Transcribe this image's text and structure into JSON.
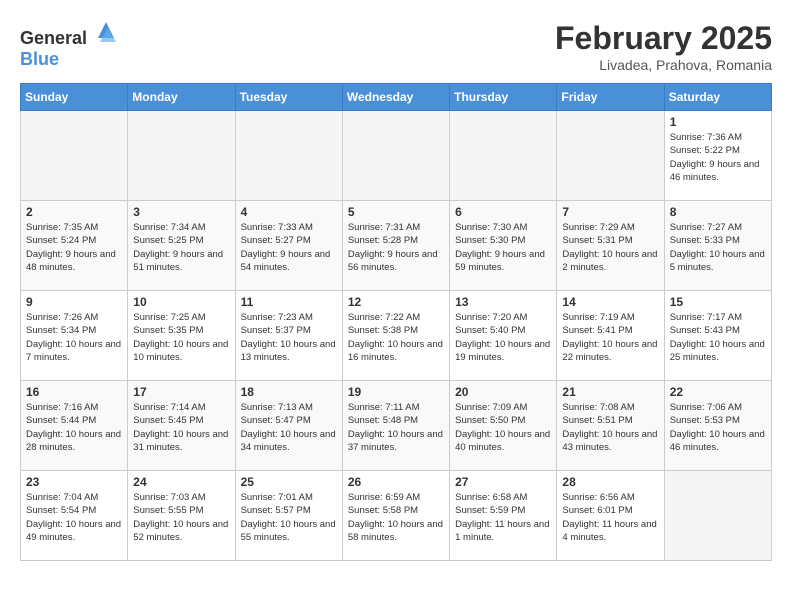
{
  "header": {
    "logo_general": "General",
    "logo_blue": "Blue",
    "title": "February 2025",
    "subtitle": "Livadea, Prahova, Romania"
  },
  "weekdays": [
    "Sunday",
    "Monday",
    "Tuesday",
    "Wednesday",
    "Thursday",
    "Friday",
    "Saturday"
  ],
  "weeks": [
    [
      {
        "day": "",
        "info": ""
      },
      {
        "day": "",
        "info": ""
      },
      {
        "day": "",
        "info": ""
      },
      {
        "day": "",
        "info": ""
      },
      {
        "day": "",
        "info": ""
      },
      {
        "day": "",
        "info": ""
      },
      {
        "day": "1",
        "info": "Sunrise: 7:36 AM\nSunset: 5:22 PM\nDaylight: 9 hours and 46 minutes."
      }
    ],
    [
      {
        "day": "2",
        "info": "Sunrise: 7:35 AM\nSunset: 5:24 PM\nDaylight: 9 hours and 48 minutes."
      },
      {
        "day": "3",
        "info": "Sunrise: 7:34 AM\nSunset: 5:25 PM\nDaylight: 9 hours and 51 minutes."
      },
      {
        "day": "4",
        "info": "Sunrise: 7:33 AM\nSunset: 5:27 PM\nDaylight: 9 hours and 54 minutes."
      },
      {
        "day": "5",
        "info": "Sunrise: 7:31 AM\nSunset: 5:28 PM\nDaylight: 9 hours and 56 minutes."
      },
      {
        "day": "6",
        "info": "Sunrise: 7:30 AM\nSunset: 5:30 PM\nDaylight: 9 hours and 59 minutes."
      },
      {
        "day": "7",
        "info": "Sunrise: 7:29 AM\nSunset: 5:31 PM\nDaylight: 10 hours and 2 minutes."
      },
      {
        "day": "8",
        "info": "Sunrise: 7:27 AM\nSunset: 5:33 PM\nDaylight: 10 hours and 5 minutes."
      }
    ],
    [
      {
        "day": "9",
        "info": "Sunrise: 7:26 AM\nSunset: 5:34 PM\nDaylight: 10 hours and 7 minutes."
      },
      {
        "day": "10",
        "info": "Sunrise: 7:25 AM\nSunset: 5:35 PM\nDaylight: 10 hours and 10 minutes."
      },
      {
        "day": "11",
        "info": "Sunrise: 7:23 AM\nSunset: 5:37 PM\nDaylight: 10 hours and 13 minutes."
      },
      {
        "day": "12",
        "info": "Sunrise: 7:22 AM\nSunset: 5:38 PM\nDaylight: 10 hours and 16 minutes."
      },
      {
        "day": "13",
        "info": "Sunrise: 7:20 AM\nSunset: 5:40 PM\nDaylight: 10 hours and 19 minutes."
      },
      {
        "day": "14",
        "info": "Sunrise: 7:19 AM\nSunset: 5:41 PM\nDaylight: 10 hours and 22 minutes."
      },
      {
        "day": "15",
        "info": "Sunrise: 7:17 AM\nSunset: 5:43 PM\nDaylight: 10 hours and 25 minutes."
      }
    ],
    [
      {
        "day": "16",
        "info": "Sunrise: 7:16 AM\nSunset: 5:44 PM\nDaylight: 10 hours and 28 minutes."
      },
      {
        "day": "17",
        "info": "Sunrise: 7:14 AM\nSunset: 5:45 PM\nDaylight: 10 hours and 31 minutes."
      },
      {
        "day": "18",
        "info": "Sunrise: 7:13 AM\nSunset: 5:47 PM\nDaylight: 10 hours and 34 minutes."
      },
      {
        "day": "19",
        "info": "Sunrise: 7:11 AM\nSunset: 5:48 PM\nDaylight: 10 hours and 37 minutes."
      },
      {
        "day": "20",
        "info": "Sunrise: 7:09 AM\nSunset: 5:50 PM\nDaylight: 10 hours and 40 minutes."
      },
      {
        "day": "21",
        "info": "Sunrise: 7:08 AM\nSunset: 5:51 PM\nDaylight: 10 hours and 43 minutes."
      },
      {
        "day": "22",
        "info": "Sunrise: 7:06 AM\nSunset: 5:53 PM\nDaylight: 10 hours and 46 minutes."
      }
    ],
    [
      {
        "day": "23",
        "info": "Sunrise: 7:04 AM\nSunset: 5:54 PM\nDaylight: 10 hours and 49 minutes."
      },
      {
        "day": "24",
        "info": "Sunrise: 7:03 AM\nSunset: 5:55 PM\nDaylight: 10 hours and 52 minutes."
      },
      {
        "day": "25",
        "info": "Sunrise: 7:01 AM\nSunset: 5:57 PM\nDaylight: 10 hours and 55 minutes."
      },
      {
        "day": "26",
        "info": "Sunrise: 6:59 AM\nSunset: 5:58 PM\nDaylight: 10 hours and 58 minutes."
      },
      {
        "day": "27",
        "info": "Sunrise: 6:58 AM\nSunset: 5:59 PM\nDaylight: 11 hours and 1 minute."
      },
      {
        "day": "28",
        "info": "Sunrise: 6:56 AM\nSunset: 6:01 PM\nDaylight: 11 hours and 4 minutes."
      },
      {
        "day": "",
        "info": ""
      }
    ]
  ]
}
